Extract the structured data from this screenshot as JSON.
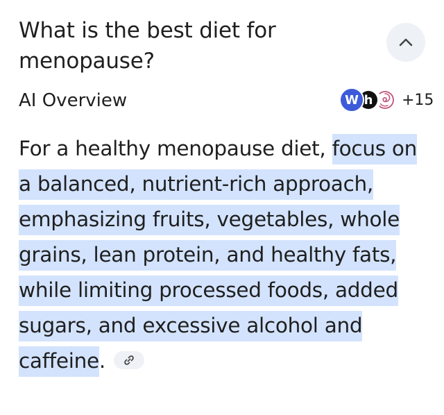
{
  "question": {
    "text": "What is the best diet for menopause?"
  },
  "header": {
    "collapse_icon": "chevron-up-icon"
  },
  "overview": {
    "label": "AI Overview",
    "sources": {
      "icons": [
        "w-source-icon",
        "h-source-icon",
        "swirl-source-icon"
      ],
      "w_letter": "W",
      "h_letter": "h",
      "more_count": "+15"
    }
  },
  "answer": {
    "plain_intro": "For a healthy menopause diet, ",
    "highlighted": "focus on a balanced, nutrient-rich approach, emphasizing fruits, vegetables, whole grains, lean protein, and healthy fats, while limiting processed foods, added sugars, and excessive alcohol and caffeine",
    "end": ".",
    "link_icon": "link-icon"
  },
  "colors": {
    "highlight": "#d3e3fd",
    "button_bg": "#eef1f6",
    "text": "#1f1f1f",
    "w_source": "#3d5bd9"
  }
}
